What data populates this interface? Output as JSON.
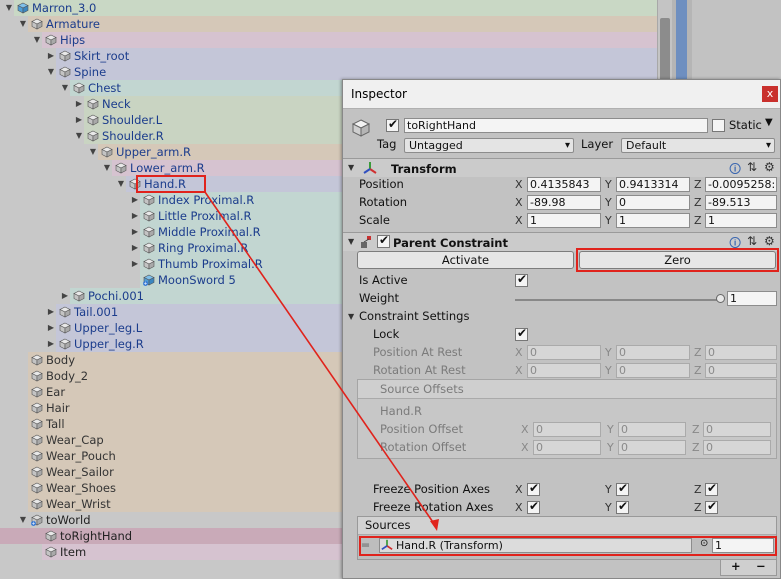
{
  "hierarchy": {
    "rows": [
      {
        "label": "Marron_3.0",
        "depth": 0,
        "expanded": true,
        "prefab": true,
        "color": "#c9d8c5"
      },
      {
        "label": "Armature",
        "depth": 1,
        "expanded": true,
        "color": "#d5c8b8"
      },
      {
        "label": "Hips",
        "depth": 2,
        "expanded": true,
        "color": "#d6c3d0"
      },
      {
        "label": "Skirt_root",
        "depth": 3,
        "expanded": false,
        "color": "#c4c6d8"
      },
      {
        "label": "Spine",
        "depth": 3,
        "expanded": true,
        "color": "#c4c6d8"
      },
      {
        "label": "Chest",
        "depth": 4,
        "expanded": true,
        "color": "#c2d6d1"
      },
      {
        "label": "Neck",
        "depth": 5,
        "expanded": false,
        "color": "#c9d4c2"
      },
      {
        "label": "Shoulder.L",
        "depth": 5,
        "expanded": false,
        "color": "#c9d4c2"
      },
      {
        "label": "Shoulder.R",
        "depth": 5,
        "expanded": true,
        "color": "#c9d4c2"
      },
      {
        "label": "Upper_arm.R",
        "depth": 6,
        "expanded": true,
        "color": "#d5c8b8"
      },
      {
        "label": "Lower_arm.R",
        "depth": 7,
        "expanded": true,
        "color": "#d6c3d0"
      },
      {
        "label": "Hand.R",
        "depth": 8,
        "expanded": true,
        "color": "#c4c6d8",
        "highlight": true
      },
      {
        "label": "Index Proximal.R",
        "depth": 9,
        "expanded": false,
        "color": "#c2d6d1"
      },
      {
        "label": "Little Proximal.R",
        "depth": 9,
        "expanded": false,
        "color": "#c2d6d1"
      },
      {
        "label": "Middle Proximal.R",
        "depth": 9,
        "expanded": false,
        "color": "#c2d6d1"
      },
      {
        "label": "Ring Proximal.R",
        "depth": 9,
        "expanded": false,
        "color": "#c2d6d1"
      },
      {
        "label": "Thumb Proximal.R",
        "depth": 9,
        "expanded": false,
        "color": "#c2d6d1"
      },
      {
        "label": "MoonSword 5",
        "depth": 9,
        "expanded": null,
        "prefab": true,
        "added": true,
        "color": "#c2d6d1"
      },
      {
        "label": "Pochi.001",
        "depth": 4,
        "expanded": false,
        "color": "#c2d6d1"
      },
      {
        "label": "Tail.001",
        "depth": 3,
        "expanded": false,
        "color": "#c4c6d8"
      },
      {
        "label": "Upper_leg.L",
        "depth": 3,
        "expanded": false,
        "color": "#c4c6d8"
      },
      {
        "label": "Upper_leg.R",
        "depth": 3,
        "expanded": false,
        "color": "#c4c6d8"
      },
      {
        "label": "Body",
        "depth": 1,
        "expanded": null,
        "color": "#d5c8b8"
      },
      {
        "label": "Body_2",
        "depth": 1,
        "expanded": null,
        "color": "#d5c8b8"
      },
      {
        "label": "Ear",
        "depth": 1,
        "expanded": null,
        "color": "#d5c8b8"
      },
      {
        "label": "Hair",
        "depth": 1,
        "expanded": null,
        "color": "#d5c8b8"
      },
      {
        "label": "Tall",
        "depth": 1,
        "expanded": null,
        "color": "#d5c8b8"
      },
      {
        "label": "Wear_Cap",
        "depth": 1,
        "expanded": null,
        "color": "#d5c8b8"
      },
      {
        "label": "Wear_Pouch",
        "depth": 1,
        "expanded": null,
        "color": "#d5c8b8"
      },
      {
        "label": "Wear_Sailor",
        "depth": 1,
        "expanded": null,
        "color": "#d5c8b8"
      },
      {
        "label": "Wear_Shoes",
        "depth": 1,
        "expanded": null,
        "color": "#d5c8b8"
      },
      {
        "label": "Wear_Wrist",
        "depth": 1,
        "expanded": null,
        "color": "#d5c8b8"
      },
      {
        "label": "toWorld",
        "depth": 1,
        "expanded": true,
        "color": "#c8c8c8",
        "plain": true,
        "added": true
      },
      {
        "label": "toRightHand",
        "depth": 2,
        "expanded": null,
        "color": "#c9aab8",
        "selected": true
      },
      {
        "label": "Item",
        "depth": 2,
        "expanded": null,
        "color": "#d6c3d0"
      }
    ]
  },
  "inspector": {
    "title": "Inspector",
    "object": {
      "active": true,
      "name": "toRightHand",
      "static_label": "Static",
      "static": false,
      "tag_label": "Tag",
      "tag_value": "Untagged",
      "layer_label": "Layer",
      "layer_value": "Default"
    },
    "transform": {
      "name": "Transform",
      "position_label": "Position",
      "rotation_label": "Rotation",
      "scale_label": "Scale",
      "position": {
        "x": "0.4135843",
        "y": "0.9413314",
        "z": "-0.0095258:"
      },
      "rotation": {
        "x": "-89.98",
        "y": "0",
        "z": "-89.513"
      },
      "scale": {
        "x": "1",
        "y": "1",
        "z": "1"
      }
    },
    "parent_constraint": {
      "name": "Parent Constraint",
      "enabled": true,
      "activate_label": "Activate",
      "zero_label": "Zero",
      "is_active_label": "Is Active",
      "is_active": true,
      "weight_label": "Weight",
      "weight": "1",
      "weight_level": 1.0,
      "settings_label": "Constraint Settings",
      "lock_label": "Lock",
      "lock": true,
      "position_at_rest_label": "Position At Rest",
      "rotation_at_rest_label": "Rotation At Rest",
      "position_at_rest": {
        "x": "0",
        "y": "0",
        "z": "0"
      },
      "rotation_at_rest": {
        "x": "0",
        "y": "0",
        "z": "0"
      },
      "source_offsets_label": "Source Offsets",
      "source_offset_name": "Hand.R",
      "position_offset_label": "Position Offset",
      "rotation_offset_label": "Rotation Offset",
      "position_offset": {
        "x": "0",
        "y": "0",
        "z": "0"
      },
      "rotation_offset": {
        "x": "0",
        "y": "0",
        "z": "0"
      },
      "freeze_position_label": "Freeze Position Axes",
      "freeze_rotation_label": "Freeze Rotation Axes",
      "sources_label": "Sources",
      "source_entry": "Hand.R (Transform)",
      "source_weight": "1",
      "add_label": "+",
      "remove_label": "−"
    },
    "axis_labels": {
      "x": "X",
      "y": "Y",
      "z": "Z"
    }
  },
  "colors": {
    "annotation": "#e0231c",
    "selection": "#c9aab8"
  }
}
